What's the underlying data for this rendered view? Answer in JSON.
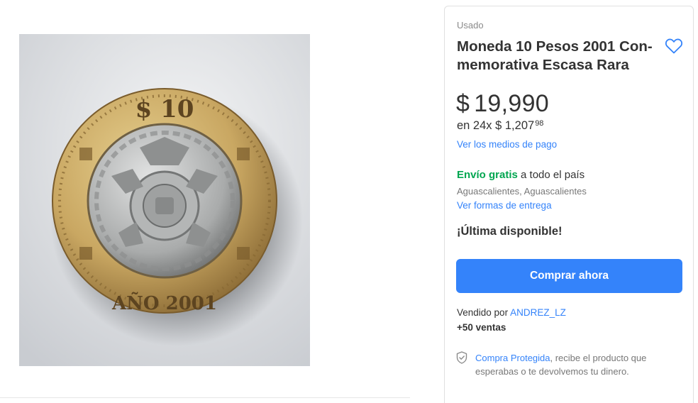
{
  "gallery": {
    "image_alt": "Moneda de 10 pesos bimetálica año 2001",
    "coin_top_text": "$ 10",
    "coin_bottom_text": "AÑO 2001"
  },
  "product": {
    "condition": "Usado",
    "title": "Moneda 10 Pesos 2001 Con-memorativa Escasa Rara",
    "currency_symbol": "$",
    "price": "19,990",
    "installments_prefix": "en 24x $ 1,207",
    "installments_cents": "98",
    "payment_methods_link": "Ver los medios de pago",
    "favorite_icon": "heart-outline-icon"
  },
  "shipping": {
    "free_label": "Envío gratis",
    "rest_label": " a todo el país",
    "location": "Aguascalientes, Aguascalientes",
    "delivery_link": "Ver formas de entrega"
  },
  "stock": {
    "label": "¡Última disponible!"
  },
  "buy": {
    "label": "Comprar ahora"
  },
  "seller": {
    "prefix": "Vendido por ",
    "name": "ANDREZ_LZ",
    "sales": "+50 ventas"
  },
  "protection": {
    "icon": "shield-check-icon",
    "link": "Compra Protegida",
    "text": ", recibe el producto que esperabas o te devolvemos tu dinero."
  },
  "colors": {
    "accent": "#3483fa",
    "free_shipping": "#00a650",
    "text": "#333333",
    "muted": "#8a8a8a"
  }
}
